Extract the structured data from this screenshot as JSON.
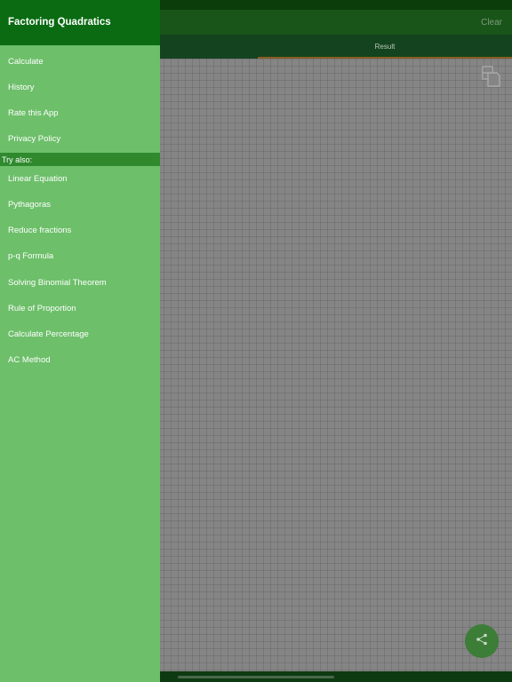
{
  "app": {
    "clear_label": "Clear",
    "tabs": [
      {
        "label": "Result"
      }
    ],
    "copy_icon": "copy-icon",
    "share_icon": "share-icon"
  },
  "drawer": {
    "title": "Factoring Quadratics",
    "main_items": [
      {
        "label": "Calculate"
      },
      {
        "label": "History"
      },
      {
        "label": "Rate this App"
      },
      {
        "label": "Privacy Policy"
      }
    ],
    "section_label": "Try also:",
    "other_apps": [
      {
        "label": "Linear Equation"
      },
      {
        "label": "Pythagoras"
      },
      {
        "label": "Reduce fractions"
      },
      {
        "label": "p-q Formula"
      },
      {
        "label": "Solving Binomial Theorem"
      },
      {
        "label": "Rule of Proportion"
      },
      {
        "label": "Calculate Percentage"
      },
      {
        "label": "AC Method"
      }
    ]
  },
  "colors": {
    "drawer_bg": "#6dbf6a",
    "drawer_header": "#0a6b12",
    "section_header": "#2f8a2e",
    "fab": "#3c7d37",
    "tab_indicator": "#8a5d21"
  }
}
